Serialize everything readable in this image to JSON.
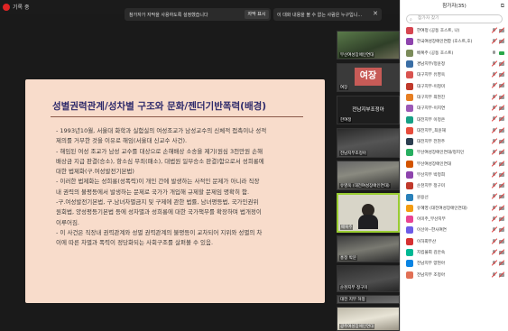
{
  "recording": {
    "label": "기록 중"
  },
  "notification": {
    "text": "참가자가 자막을 사용하도록 설정했습니다",
    "button": "자막 표시"
  },
  "notification2": {
    "text": "이 대화 내용을 볼 수 없는 사람은 누구입니..."
  },
  "slide": {
    "title": "성별권력관계/성차별 구조와 문화/젠더기반폭력(배경)",
    "lines": [
      "- 1993년10월, 서울대 화학과 실험실의 여성조교가 남성교수의 신체적 접촉이나 성적",
      "제의를 거부한 것을 이유로 해임(서울대 신교수 사건).",
      "- 해임된 여성 조교가 남성 교수를 대상으로 손해배상 소송을 제기(원심 3천만원 손해",
      "배상금 지급 판결(승소), 항소심 무죄(패소), 대법원 일부승소 판결)함으로서 성희롱에",
      "대한 법제화(구.여성발전기본법)",
      "- 이러한 법제화는 성희롱(성폭력)이 개인 간에 발생하는 사적인 문제가 아니라 직장",
      "내  권력의 불평등에서 발생하는 문제로 국가가 개입해 규제할 문제임 명확히 함.",
      "-구.여성발전기본법, 구.남녀차별금지 및 구제에 관한 법률, 남녀평등법, 국가인권위",
      "원회법, 양성평등기본법 등에 성차별과 성희롱에 대한 국가책무를 확장하며 법개정이",
      "이루어짐.",
      "- 이 사건은 직장내 권력관계와 성별 권력관계의 불평등이 교차되어 지위와 성별의 차",
      "이에 따른 차별과 폭력이 정당화되는 사회구조를 살펴볼 수 있음."
    ]
  },
  "video_tiles": [
    {
      "name": "부산여성장애인연대",
      "label": "",
      "kind": "photo-green"
    },
    {
      "name": "여장",
      "label": "여장",
      "kind": "yj"
    },
    {
      "name": "한여정",
      "label": "전남지부조정아",
      "kind": "blank"
    },
    {
      "name": "전남지부조정아",
      "label": "",
      "kind": "photo-dark"
    },
    {
      "name": "유영욱 (대전여성장애인연대)",
      "label": "",
      "kind": "photo-dark"
    },
    {
      "name": "배복주",
      "label": "",
      "kind": "speaker"
    },
    {
      "name": "홍정 박문",
      "label": "",
      "kind": "photo-dark"
    },
    {
      "name": "순천지부 정구미",
      "label": "",
      "kind": "photo-dark"
    },
    {
      "name": "대전 지부 허정",
      "label": "",
      "kind": "photo-dark"
    },
    {
      "name": "광주여성장애인연대",
      "label": "",
      "kind": "photo-light"
    }
  ],
  "participants_panel": {
    "title": "참가자(35)",
    "search_placeholder": "참가자 찾기",
    "participants": [
      {
        "name": "한여정 (공동 호스트, 나)",
        "color": "#d64550",
        "mic_muted": true,
        "cam_muted": true
      },
      {
        "name": "한국여성장애인연합 (호스트,호)",
        "color": "#8e44ad",
        "mic_muted": true,
        "cam_muted": true
      },
      {
        "name": "배복주 (공동 호스트)",
        "color": "#7b8b5a",
        "mic_muted": false,
        "cam_muted": false
      },
      {
        "name": "경남지부/정윤정",
        "color": "#3a6ea5",
        "mic_muted": true,
        "cam_muted": true
      },
      {
        "name": "대구지부 유영욱",
        "color": "#d9534f",
        "mic_muted": true,
        "cam_muted": true
      },
      {
        "name": "대구지부-이정미",
        "color": "#c0392b",
        "mic_muted": true,
        "cam_muted": true
      },
      {
        "name": "대구지부 최현진",
        "color": "#e67e22",
        "mic_muted": true,
        "cam_muted": true
      },
      {
        "name": "대구지부-이지연",
        "color": "#9b59b6",
        "mic_muted": true,
        "cam_muted": true
      },
      {
        "name": "대전지부 이정은",
        "color": "#16a085",
        "mic_muted": true,
        "cam_muted": true
      },
      {
        "name": "대전지부_최윤해",
        "color": "#e74c3c",
        "mic_muted": true,
        "cam_muted": true
      },
      {
        "name": "대전지부 전현주",
        "color": "#2c3e50",
        "mic_muted": true,
        "cam_muted": true
      },
      {
        "name": "부산여성장애인연대/정지인",
        "color": "#27ae60",
        "mic_muted": true,
        "cam_muted": true
      },
      {
        "name": "부산여성장애인연대",
        "color": "#d35400",
        "mic_muted": true,
        "cam_muted": true
      },
      {
        "name": "부산지부 박정희",
        "color": "#8e44ad",
        "mic_muted": true,
        "cam_muted": true
      },
      {
        "name": "순천지부 정구미",
        "color": "#c0392b",
        "mic_muted": true,
        "cam_muted": true
      },
      {
        "name": "원용선",
        "color": "#2980b9",
        "mic_muted": true,
        "cam_muted": true
      },
      {
        "name": "유혜영 (대전여성장애인연대)",
        "color": "#f39c12",
        "mic_muted": true,
        "cam_muted": true
      },
      {
        "name": "이미주_부산지부",
        "color": "#e84393",
        "mic_muted": true,
        "cam_muted": true
      },
      {
        "name": "이선아--한사여연",
        "color": "#6c5ce7",
        "mic_muted": true,
        "cam_muted": true
      },
      {
        "name": "이하회부산",
        "color": "#d63031",
        "mic_muted": true,
        "cam_muted": true
      },
      {
        "name": "지킴물회 김안숙",
        "color": "#00b894",
        "mic_muted": true,
        "cam_muted": true
      },
      {
        "name": "전남지부 양현아",
        "color": "#0984e3",
        "mic_muted": true,
        "cam_muted": true
      },
      {
        "name": "전남지부 조정아",
        "color": "#e17055",
        "mic_muted": true,
        "cam_muted": true
      }
    ]
  }
}
